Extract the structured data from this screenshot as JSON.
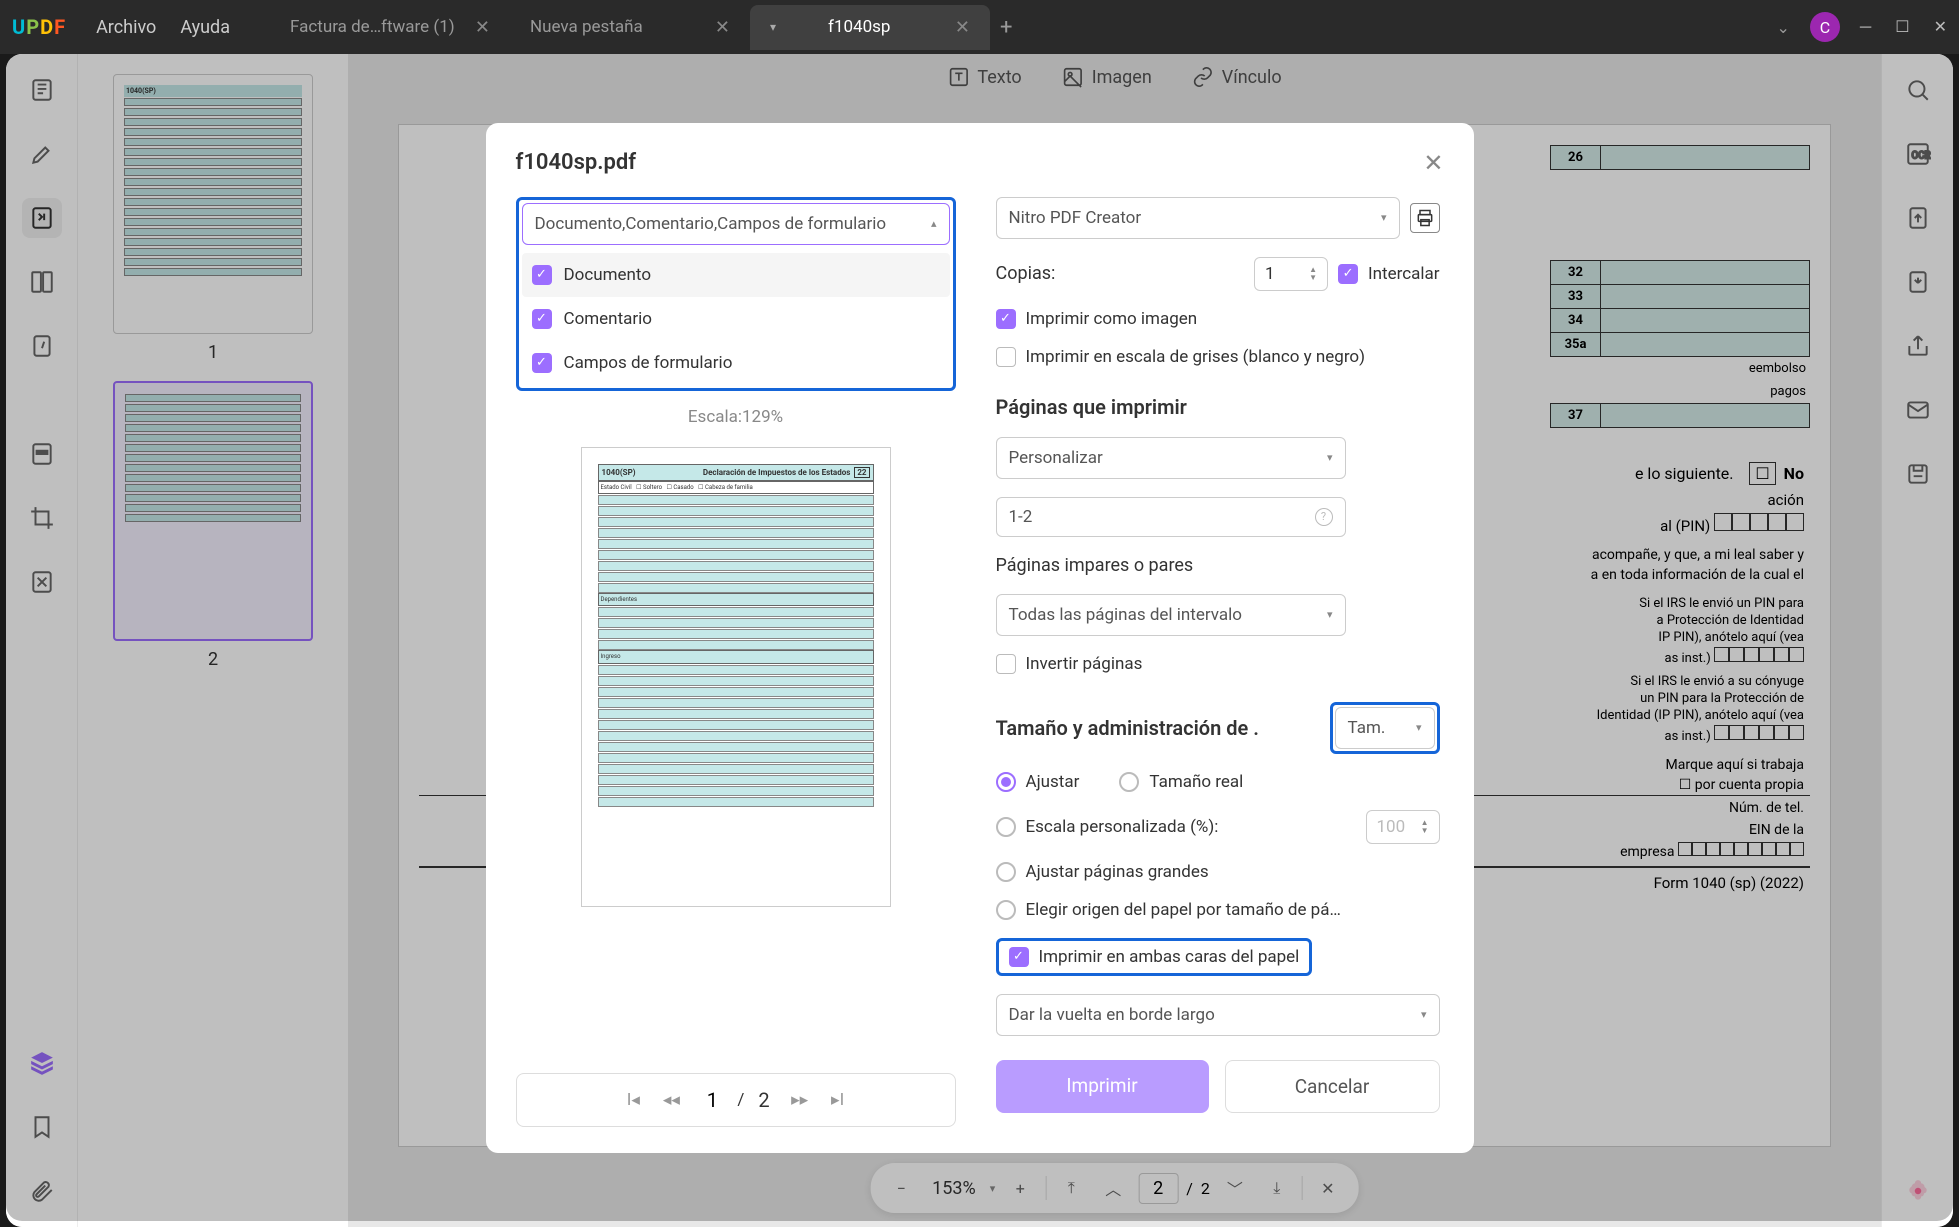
{
  "titlebar": {
    "logo": "UPDF",
    "menu": {
      "file": "Archivo",
      "help": "Ayuda"
    },
    "tabs": [
      {
        "label": "Factura de…ftware (1)"
      },
      {
        "label": "Nueva pestaña"
      },
      {
        "label": "f1040sp"
      }
    ],
    "avatar": "C"
  },
  "thumbnails": {
    "page1": "1",
    "page2": "2"
  },
  "toolbar": {
    "text": "Texto",
    "image": "Imagen",
    "link": "Vínculo"
  },
  "bottombar": {
    "zoom": "153%",
    "page_current": "2",
    "page_total": "2"
  },
  "doc": {
    "rows": {
      "r32": "32",
      "r33": "33",
      "r34": "34",
      "r35a": "35a",
      "r37": "37"
    },
    "line_siguiente": "e lo siguiente.",
    "no": "No",
    "pin_text": "ación",
    "pin_text2": "al (PIN)",
    "acompane": "acompañe, y que, a mi leal saber y",
    "acompane2": "a en toda información de la cual el",
    "irs1a": "Si el IRS le envió un PIN para",
    "irs1b": "a Protección de Identidad",
    "irs1c": "IP PIN), anótelo aquí (vea",
    "irs1d": "as inst.)",
    "irs2a": "Si el IRS le envió a su cónyuge",
    "irs2b": "un PIN para la Protección de",
    "irs2c": "Identidad (IP PIN), anótelo aquí (vea",
    "irs2d": "as inst.)",
    "marque": "Marque aquí si trabaja",
    "cuenta": "por cuenta propia",
    "tel": "Núm. de tel.",
    "ein1": "EIN de la",
    "ein2": "empresa",
    "form_footer": "Form 1040 (sp) (2022)",
    "reembolso": "eembolso",
    "pagos": "pagos"
  },
  "modal": {
    "title": "f1040sp.pdf",
    "content_dropdown": {
      "value": "Documento,Comentario,Campos de formulario",
      "options": {
        "doc": "Documento",
        "comment": "Comentario",
        "fields": "Campos de formulario"
      }
    },
    "scale": "Escala:129%",
    "pager": {
      "current": "1",
      "total": "2"
    },
    "printer": "Nitro PDF Creator",
    "copies_label": "Copias:",
    "copies_value": "1",
    "collate": "Intercalar",
    "print_as_image": "Imprimir como imagen",
    "grayscale": "Imprimir en escala de grises (blanco y negro)",
    "pages_heading": "Páginas que imprimir",
    "pages_mode": "Personalizar",
    "pages_range": "1-2",
    "odd_even_label": "Páginas impares o pares",
    "odd_even_value": "Todas las páginas del intervalo",
    "reverse": "Invertir páginas",
    "size_heading": "Tamaño y administración de .",
    "size_select": "Tam.",
    "fit": "Ajustar",
    "actual": "Tamaño real",
    "custom_scale": "Escala personalizada (%):",
    "custom_scale_value": "100",
    "fit_large": "Ajustar páginas grandes",
    "paper_source": "Elegir origen del papel por tamaño de pá…",
    "both_sides": "Imprimir en ambas caras del papel",
    "flip": "Dar la vuelta en borde largo",
    "print_btn": "Imprimir",
    "cancel_btn": "Cancelar",
    "preview_header_left": "1040(SP)",
    "preview_header_right": "22"
  }
}
